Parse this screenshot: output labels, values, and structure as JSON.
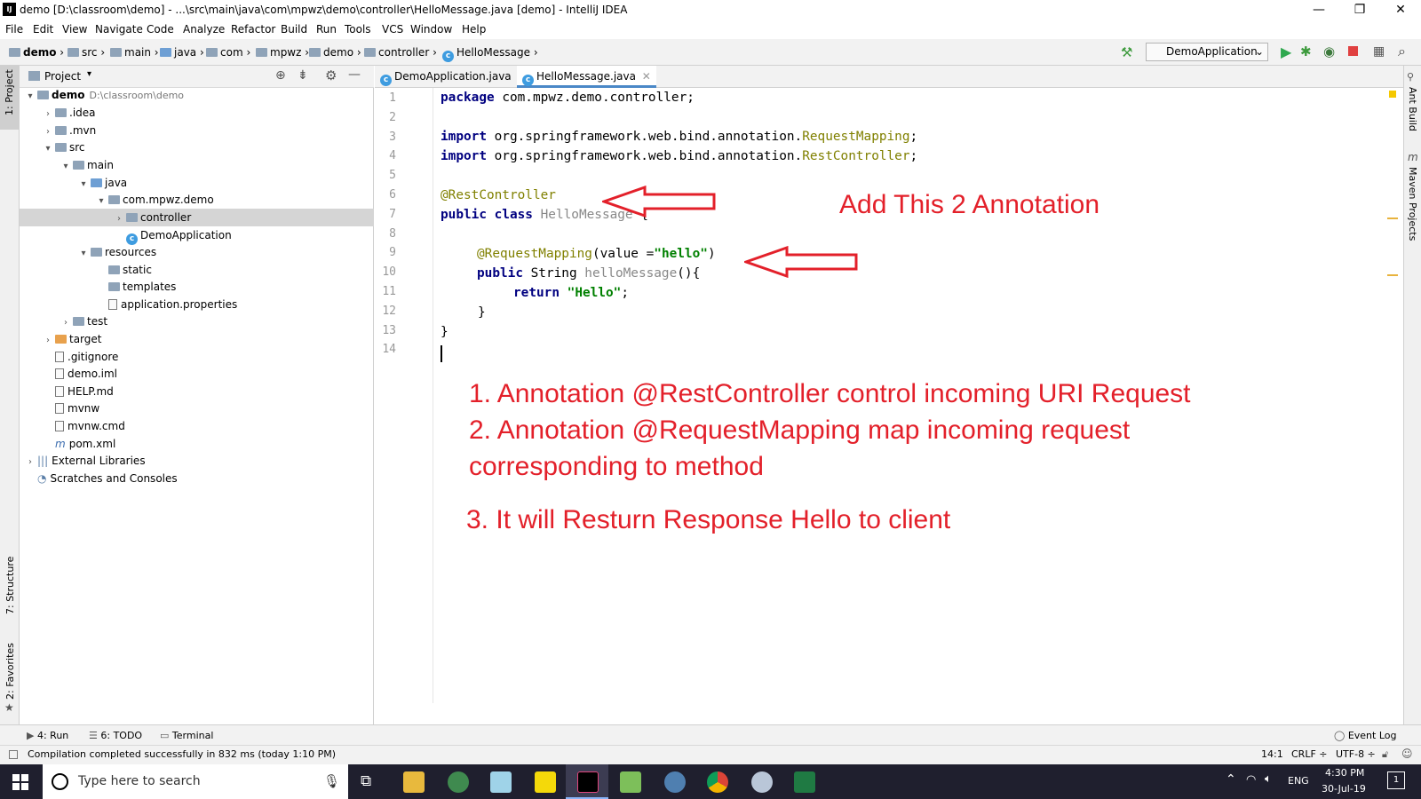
{
  "window": {
    "title": "demo [D:\\classroom\\demo] - ...\\src\\main\\java\\com\\mpwz\\demo\\controller\\HelloMessage.java [demo] - IntelliJ IDEA",
    "minimize": "—",
    "restore": "❐",
    "close": "✕"
  },
  "menu": [
    "File",
    "Edit",
    "View",
    "Navigate",
    "Code",
    "Analyze",
    "Refactor",
    "Build",
    "Run",
    "Tools",
    "VCS",
    "Window",
    "Help"
  ],
  "breadcrumb": [
    "demo",
    "src",
    "main",
    "java",
    "com",
    "mpwz",
    "demo",
    "controller",
    "HelloMessage"
  ],
  "run_config": "DemoApplication",
  "project_panel": {
    "title": "Project",
    "tree": [
      {
        "label": "demo",
        "extra": "D:\\classroom\\demo",
        "arrow": "▾",
        "icon": "folder"
      },
      {
        "label": ".idea",
        "arrow": "›",
        "icon": "folder"
      },
      {
        "label": ".mvn",
        "arrow": "›",
        "icon": "folder"
      },
      {
        "label": "src",
        "arrow": "▾",
        "icon": "folder"
      },
      {
        "label": "main",
        "arrow": "▾",
        "icon": "folder"
      },
      {
        "label": "java",
        "arrow": "▾",
        "icon": "folder-blue"
      },
      {
        "label": "com.mpwz.demo",
        "arrow": "▾",
        "icon": "folder"
      },
      {
        "label": "controller",
        "arrow": "›",
        "icon": "folder"
      },
      {
        "label": "DemoApplication",
        "arrow": "",
        "icon": "class"
      },
      {
        "label": "resources",
        "arrow": "▾",
        "icon": "folder"
      },
      {
        "label": "static",
        "arrow": "",
        "icon": "folder"
      },
      {
        "label": "templates",
        "arrow": "",
        "icon": "folder"
      },
      {
        "label": "application.properties",
        "arrow": "",
        "icon": "file"
      },
      {
        "label": "test",
        "arrow": "›",
        "icon": "folder"
      },
      {
        "label": "target",
        "arrow": "›",
        "icon": "folder-orange"
      },
      {
        "label": ".gitignore",
        "arrow": "",
        "icon": "file"
      },
      {
        "label": "demo.iml",
        "arrow": "",
        "icon": "file"
      },
      {
        "label": "HELP.md",
        "arrow": "",
        "icon": "file"
      },
      {
        "label": "mvnw",
        "arrow": "",
        "icon": "file"
      },
      {
        "label": "mvnw.cmd",
        "arrow": "",
        "icon": "file"
      },
      {
        "label": "pom.xml",
        "arrow": "",
        "icon": "maven"
      },
      {
        "label": "External Libraries",
        "arrow": "›",
        "icon": "library"
      },
      {
        "label": "Scratches and Consoles",
        "arrow": "",
        "icon": "scratch"
      }
    ]
  },
  "editor_tabs": [
    "DemoApplication.java",
    "HelloMessage.java"
  ],
  "line_numbers": [
    "1",
    "2",
    "3",
    "4",
    "5",
    "6",
    "7",
    "8",
    "9",
    "10",
    "11",
    "12",
    "13",
    "14"
  ],
  "code": {
    "l1_kw": "package",
    "l1_rest": " com.mpwz.demo.controller;",
    "l3_kw": "import",
    "l3_rest": " org.springframework.web.bind.annotation.",
    "l3_cls": "RequestMapping",
    "l3_end": ";",
    "l4_kw": "import",
    "l4_rest": " org.springframework.web.bind.annotation.",
    "l4_cls": "RestController",
    "l4_end": ";",
    "l6_ann": "@RestController",
    "l7_kw": "public class",
    "l7_name": " HelloMessage",
    "l7_rest": " {",
    "l9_ann": "@RequestMapping",
    "l9_a": "(value =",
    "l9_str": "\"hello\"",
    "l9_b": ")",
    "l10_kw": "public",
    "l10_a": " String ",
    "l10_name": "helloMessage",
    "l10_b": "(){",
    "l11_kw": "return",
    "l11_sp": " ",
    "l11_str": "\"Hello\"",
    "l11_end": ";",
    "l12": "}",
    "l13": "}"
  },
  "annotations": {
    "heading": "Add This 2 Annotation",
    "note1": "1. Annotation @RestController control incoming URI Request",
    "note2a": "2. Annotation @RequestMapping map incoming request",
    "note2b": "corresponding to method",
    "note3": "3. It will Resturn Response Hello to client",
    "color": "#e3202a"
  },
  "left_strip": {
    "project": "1: Project",
    "structure": "7: Structure",
    "favorites": "2: Favorites"
  },
  "right_strip": {
    "ant": "Ant Build",
    "maven": "Maven Projects"
  },
  "bottom_tools": {
    "run": "4: Run",
    "todo": "6: TODO",
    "terminal": "Terminal",
    "event_log": "Event Log"
  },
  "status": {
    "message": "Compilation completed successfully in 832 ms (today 1:10 PM)",
    "position": "14:1",
    "line_sep": "CRLF ÷",
    "encoding": "UTF-8 ÷"
  },
  "taskbar": {
    "search_placeholder": "Type here to search",
    "lang": "ENG",
    "time": "4:30 PM",
    "date": "30-Jul-19",
    "notif": "1"
  }
}
